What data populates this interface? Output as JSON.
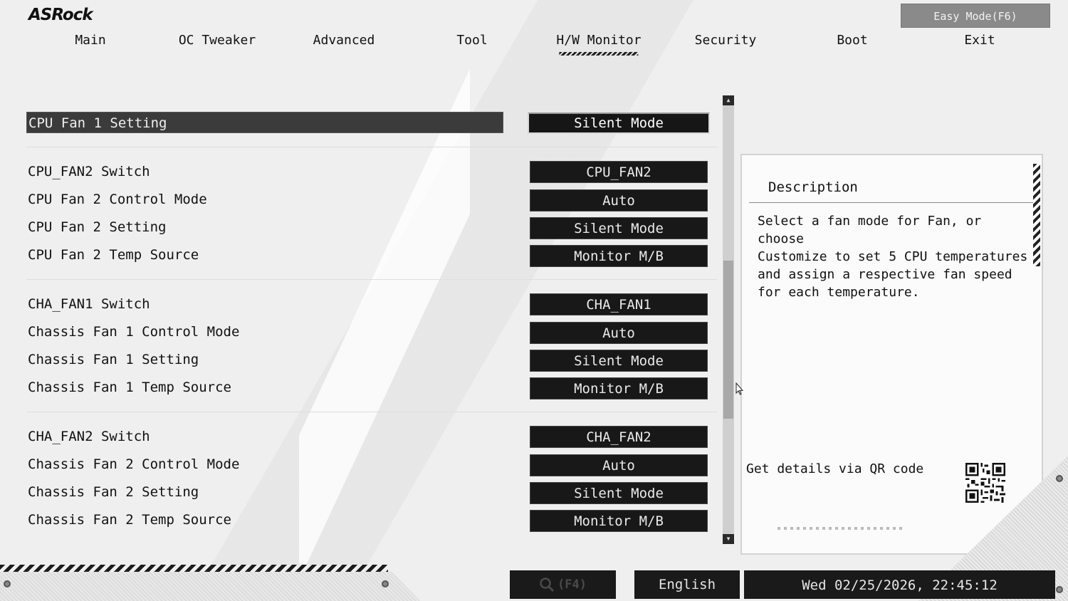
{
  "brand": "ASRock",
  "easy_mode": "Easy Mode(F6)",
  "tabs": [
    {
      "label": "Main"
    },
    {
      "label": "OC Tweaker"
    },
    {
      "label": "Advanced"
    },
    {
      "label": "Tool"
    },
    {
      "label": "H/W Monitor"
    },
    {
      "label": "Security"
    },
    {
      "label": "Boot"
    },
    {
      "label": "Exit"
    }
  ],
  "settings": [
    {
      "label": "CPU Fan 1 Setting",
      "value": "Silent Mode"
    },
    {
      "label": "CPU_FAN2 Switch",
      "value": "CPU_FAN2"
    },
    {
      "label": "CPU Fan 2 Control Mode",
      "value": "Auto"
    },
    {
      "label": "CPU Fan 2 Setting",
      "value": "Silent Mode"
    },
    {
      "label": "CPU Fan 2 Temp Source",
      "value": "Monitor M/B"
    },
    {
      "label": "CHA_FAN1 Switch",
      "value": "CHA_FAN1"
    },
    {
      "label": "Chassis Fan 1 Control Mode",
      "value": "Auto"
    },
    {
      "label": "Chassis Fan 1 Setting",
      "value": "Silent Mode"
    },
    {
      "label": "Chassis Fan 1 Temp Source",
      "value": "Monitor M/B"
    },
    {
      "label": "CHA_FAN2 Switch",
      "value": "CHA_FAN2"
    },
    {
      "label": "Chassis Fan 2 Control Mode",
      "value": "Auto"
    },
    {
      "label": "Chassis Fan 2 Setting",
      "value": "Silent Mode"
    },
    {
      "label": "Chassis Fan 2 Temp Source",
      "value": "Monitor M/B"
    }
  ],
  "description": {
    "title": "Description",
    "lines": [
      "Select a fan mode for Fan, or choose",
      "Customize to set 5 CPU temperatures",
      "and assign a respective fan speed",
      "for each temperature."
    ],
    "qr_label": "Get details via QR code"
  },
  "footer": {
    "search_label": "(F4)",
    "language": "English",
    "datetime": "Wed 02/25/2026, 22:45:12"
  }
}
